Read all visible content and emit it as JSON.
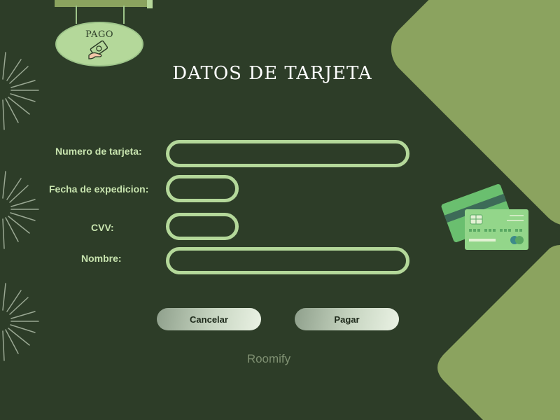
{
  "sign": {
    "text": "PAGO"
  },
  "title": "DATOS DE TARJETA",
  "form": {
    "card_number_label": "Numero de tarjeta:",
    "issue_date_label": "Fecha de expedicion:",
    "cvv_label": "CVV:",
    "name_label": "Nombre:",
    "card_number_value": "",
    "issue_date_value": "",
    "cvv_value": "",
    "name_value": ""
  },
  "buttons": {
    "cancel_label": "Cancelar",
    "pay_label": "Pagar"
  },
  "footer": {
    "brand": "Roomify"
  },
  "colors": {
    "background": "#2d3d28",
    "accent": "#8ba35f",
    "field_border": "#b4d89a",
    "label": "#c7e3ae"
  },
  "icons": [
    "money-hand-icon",
    "credit-cards-illustration",
    "sunburst-decoration"
  ]
}
